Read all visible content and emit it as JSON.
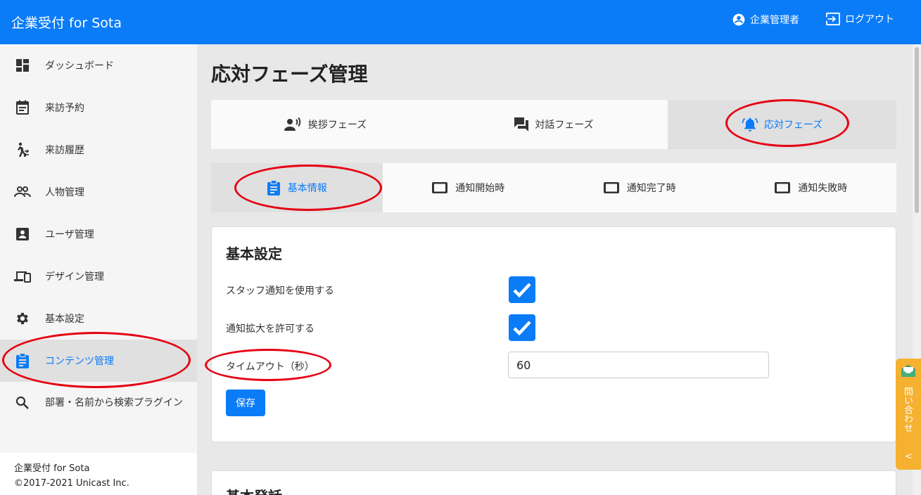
{
  "header": {
    "app_title": "企業受付 for Sota",
    "user_label": "企業管理者",
    "logout_label": "ログアウト"
  },
  "sidebar": {
    "items": [
      {
        "label": "ダッシュボード",
        "icon": "dashboard-icon"
      },
      {
        "label": "来訪予約",
        "icon": "calendar-icon"
      },
      {
        "label": "来訪履歴",
        "icon": "walk-icon"
      },
      {
        "label": "人物管理",
        "icon": "people-icon"
      },
      {
        "label": "ユーザ管理",
        "icon": "account-box-icon"
      },
      {
        "label": "デザイン管理",
        "icon": "devices-icon"
      },
      {
        "label": "基本設定",
        "icon": "gear-icon"
      },
      {
        "label": "コンテンツ管理",
        "icon": "clipboard-icon",
        "active": true
      },
      {
        "label": "部署・名前から検索プラグイン",
        "icon": "search-icon"
      }
    ],
    "footer_line1": "企業受付 for Sota",
    "footer_line2": "©2017-2021 Unicast Inc."
  },
  "page": {
    "title": "応対フェーズ管理"
  },
  "phase_tabs": [
    {
      "label": "挨拶フェーズ",
      "icon": "voice-icon"
    },
    {
      "label": "対話フェーズ",
      "icon": "chat-icon"
    },
    {
      "label": "応対フェーズ",
      "icon": "bell-icon",
      "active": true
    }
  ],
  "sub_tabs": [
    {
      "label": "基本情報",
      "icon": "clipboard-icon",
      "active": true
    },
    {
      "label": "通知開始時",
      "icon": "tablet-icon"
    },
    {
      "label": "通知完了時",
      "icon": "tablet-icon"
    },
    {
      "label": "通知失敗時",
      "icon": "tablet-icon"
    }
  ],
  "settings_card": {
    "title": "基本設定",
    "staff_notify_label": "スタッフ通知を使用する",
    "staff_notify_checked": true,
    "notify_zoom_label": "通知拡大を許可する",
    "notify_zoom_checked": true,
    "timeout_label": "タイムアウト（秒）",
    "timeout_value": "60",
    "save_label": "保存"
  },
  "second_card": {
    "title": "基本発話"
  },
  "contact_tab": {
    "label": "問い合わせ",
    "chevron": "<"
  },
  "colors": {
    "primary": "#0a7cf8",
    "annotation": "#e60012",
    "contact": "#f6b130"
  }
}
